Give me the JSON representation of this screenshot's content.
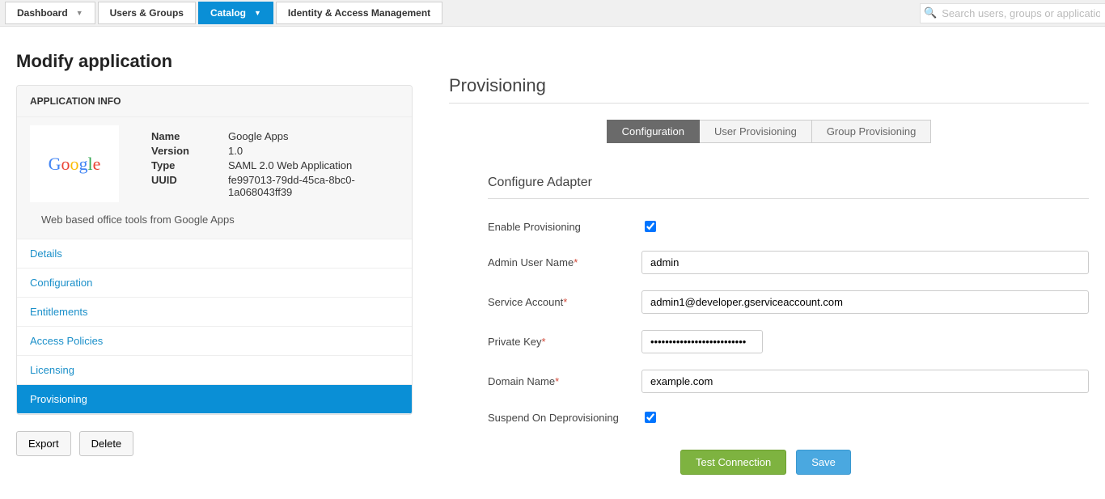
{
  "top_nav": {
    "tabs": [
      {
        "label": "Dashboard",
        "has_chevron": true,
        "active": false
      },
      {
        "label": "Users & Groups",
        "has_chevron": false,
        "active": false
      },
      {
        "label": "Catalog",
        "has_chevron": true,
        "active": true
      },
      {
        "label": "Identity & Access Management",
        "has_chevron": false,
        "active": false
      }
    ],
    "search_placeholder": "Search users, groups or application"
  },
  "page_title": "Modify application",
  "panel": {
    "heading": "APPLICATION INFO",
    "logo_text": "Google",
    "fields": {
      "name_label": "Name",
      "name_value": "Google Apps",
      "version_label": "Version",
      "version_value": "1.0",
      "type_label": "Type",
      "type_value": "SAML 2.0 Web Application",
      "uuid_label": "UUID",
      "uuid_value": "fe997013-79dd-45ca-8bc0-1a068043ff39"
    },
    "description": "Web based office tools from Google Apps",
    "nav": [
      {
        "label": "Details",
        "active": false
      },
      {
        "label": "Configuration",
        "active": false
      },
      {
        "label": "Entitlements",
        "active": false
      },
      {
        "label": "Access Policies",
        "active": false
      },
      {
        "label": "Licensing",
        "active": false
      },
      {
        "label": "Provisioning",
        "active": true
      }
    ]
  },
  "buttons": {
    "export": "Export",
    "delete": "Delete"
  },
  "provisioning": {
    "title": "Provisioning",
    "tabs": [
      {
        "label": "Configuration",
        "active": true
      },
      {
        "label": "User Provisioning",
        "active": false
      },
      {
        "label": "Group Provisioning",
        "active": false
      }
    ],
    "form_title": "Configure Adapter",
    "fields": {
      "enable_label": "Enable Provisioning",
      "enable_checked": true,
      "admin_label": "Admin User Name",
      "admin_value": "admin",
      "svc_label": "Service Account",
      "svc_value": "admin1@developer.gserviceaccount.com",
      "key_label": "Private Key",
      "key_value": "••••••••••••••••••••••••••",
      "domain_label": "Domain Name",
      "domain_value": "example.com",
      "suspend_label": "Suspend On Deprovisioning",
      "suspend_checked": true
    },
    "actions": {
      "test": "Test Connection",
      "save": "Save"
    }
  }
}
